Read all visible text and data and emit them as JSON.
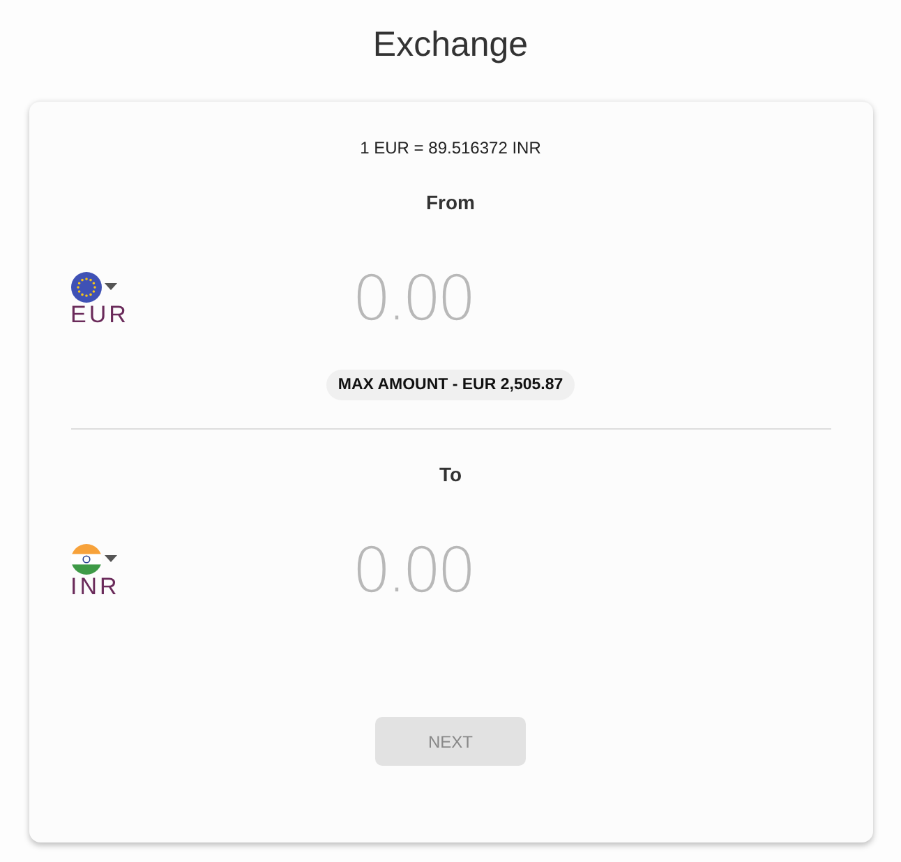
{
  "title": "Exchange",
  "rate": "1 EUR = 89.516372 INR",
  "from": {
    "label": "From",
    "currency": "EUR",
    "flag": {
      "kind": "eu"
    },
    "placeholder": "0.00",
    "max_amount": "MAX AMOUNT - EUR 2,505.87"
  },
  "to": {
    "label": "To",
    "currency": "INR",
    "flag": {
      "kind": "in"
    },
    "placeholder": "0.00"
  },
  "next_button": {
    "label": "NEXT",
    "disabled": true
  }
}
